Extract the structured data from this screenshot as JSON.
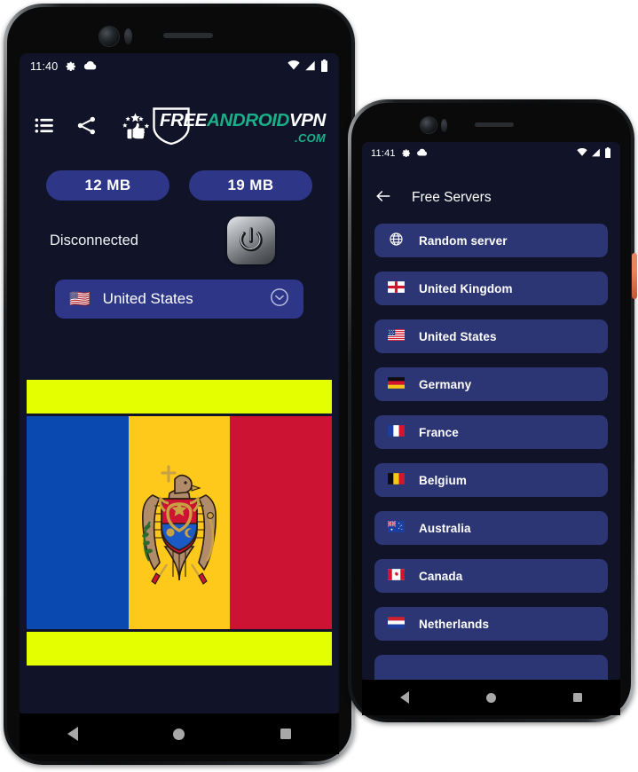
{
  "colors": {
    "screen_bg": "#111428",
    "pill_blue": "#2d3687",
    "list_blue": "#2d3675",
    "banner_yellow": "#e4ff00",
    "logo_teal": "#19b089",
    "power_button_orange": "#f08062"
  },
  "phone1": {
    "status_bar": {
      "time": "11:40",
      "left_icons": [
        "gear-icon",
        "cloud-icon"
      ],
      "right_icons": [
        "wifi-icon",
        "signal-icon",
        "battery-icon"
      ]
    },
    "toolbar": {
      "icons": [
        "list-icon",
        "share-icon",
        "rate-us-icon"
      ],
      "logo": {
        "part1": "FREE",
        "part2": "ANDROID",
        "part3": "VPN",
        "part4": ".COM",
        "shield": "shield-icon"
      }
    },
    "stats": {
      "download": "12 MB",
      "upload": "19 MB"
    },
    "connection": {
      "status": "Disconnected",
      "power_button": "power-icon"
    },
    "server_selector": {
      "flag": "🇺🇸",
      "label": "United States",
      "chevron": "chevron-down-icon"
    },
    "ad_banner": {
      "top_bar_color": "#e4ff00",
      "bottom_bar_color": "#e4ff00",
      "flag_name": "Moldova"
    },
    "nav_bar": [
      "back-button",
      "home-button",
      "recents-button"
    ]
  },
  "phone2": {
    "status_bar": {
      "time": "11:41",
      "left_icons": [
        "gear-icon",
        "cloud-icon"
      ],
      "right_icons": [
        "wifi-icon",
        "signal-icon",
        "battery-icon"
      ]
    },
    "app_bar": {
      "back": "arrow-left-icon",
      "title": "Free Servers"
    },
    "servers": [
      {
        "flag": "globe",
        "name": "Random server"
      },
      {
        "flag": "🏴󠁧󠁢󠁥󠁮󠁧󠁿",
        "name": "United Kingdom"
      },
      {
        "flag": "🇺🇸",
        "name": "United States"
      },
      {
        "flag": "🇩🇪",
        "name": "Germany"
      },
      {
        "flag": "🇫🇷",
        "name": "France"
      },
      {
        "flag": "🇧🇪",
        "name": "Belgium"
      },
      {
        "flag": "🇦🇺",
        "name": "Australia"
      },
      {
        "flag": "🇨🇦",
        "name": "Canada"
      },
      {
        "flag": "🇳🇱",
        "name": "Netherlands"
      }
    ],
    "nav_bar": [
      "back-button",
      "home-button",
      "recents-button"
    ]
  }
}
